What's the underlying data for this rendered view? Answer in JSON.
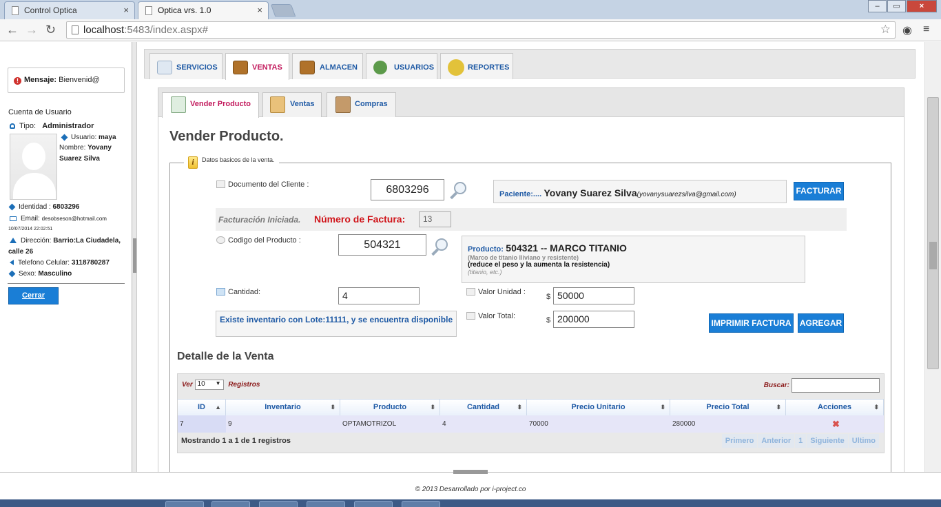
{
  "browser": {
    "tabs": [
      {
        "label": "Control Optica",
        "close": "×"
      },
      {
        "label": "Optica vrs. 1.0",
        "close": "×"
      }
    ],
    "url_host": "localhost",
    "url_rest": ":5483/index.aspx#",
    "window_buttons": [
      "–",
      "▭",
      "×"
    ]
  },
  "sidebar": {
    "message_label": "Mensaje:",
    "message_text": "Bienvenid@",
    "account_title": "Cuenta de Usuario",
    "tipo_label": "Tipo:",
    "tipo_value": "Administrador",
    "usuario_label": "Usuario:",
    "usuario_value": "maya",
    "nombre_label": "Nombre:",
    "nombre_value": "Yovany",
    "nombre_value2": "Suarez Silva",
    "identidad_label": "Identidad :",
    "identidad_value": "6803296",
    "email_label": "Email:",
    "email_value": "desobseson@hotmail.com",
    "timestamp": "10/07/2014 22:02:51",
    "direccion_label": "Dirección:",
    "direccion_value": "Barrio:La Ciudadela,",
    "direccion_value2": "calle 26",
    "telefono_label": "Telefono Celular:",
    "telefono_value": "3118780287",
    "sexo_label": "Sexo:",
    "sexo_value": "Masculino",
    "logout_label": "Cerrar Sesión"
  },
  "menu": {
    "items": [
      "SERVICIOS",
      "VENTAS",
      "ALMACEN",
      "USUARIOS",
      "REPORTES"
    ],
    "active": "VENTAS"
  },
  "subtabs": {
    "items": [
      "Vender Producto",
      "Ventas",
      "Compras"
    ],
    "active": "Vender Producto"
  },
  "form": {
    "title": "Vender Producto.",
    "legend": "Datos basicos de la venta.",
    "documento_label": "Documento del Cliente :",
    "documento_value": "6803296",
    "paciente_label": "Paciente:....",
    "paciente_name": "Yovany Suarez Silva",
    "paciente_email": "(yovanysuarezsilva@gmail.com)",
    "facturar_label": "FACTURAR",
    "facturacion_text": "Facturación Iniciada.",
    "numero_factura_label": "Número de Factura:",
    "numero_factura_value": "13",
    "codigo_label": "Codigo del Producto :",
    "codigo_value": "504321",
    "producto_label": "Producto:",
    "producto_title": "504321 -- MARCO TITANIO",
    "producto_line1": "(Marco de titanio lliviano y resistente)",
    "producto_line2": "(reduce el peso y la aumenta la resistencia)",
    "producto_line3": "(titanio, etc.)",
    "cantidad_label": "Cantidad:",
    "cantidad_value": "4",
    "valor_unidad_label": "Valor Unidad :",
    "valor_unidad_currency": "$",
    "valor_unidad_value": "50000",
    "valor_total_label": "Valor Total:",
    "valor_total_currency": "$",
    "valor_total_value": "200000",
    "inventario_msg": "Existe inventario con Lote:11111, y se encuentra disponible",
    "imprimir_label": "IMPRIMIR FACTURA",
    "agregar_label": "AGREGAR"
  },
  "detalle": {
    "title": "Detalle de la Venta",
    "ver_label": "Ver",
    "page_size": "10",
    "registros_label": "Registros",
    "buscar_label": "Buscar:",
    "columns": [
      "ID",
      "Inventario",
      "Producto",
      "Cantidad",
      "Precio Unitario",
      "Precio Total",
      "Acciones"
    ],
    "rows": [
      {
        "id": "7",
        "inventario": "9",
        "producto": "OPTAMOTRIZOL",
        "cantidad": "4",
        "precio_unitario": "70000",
        "precio_total": "280000",
        "accion": "✖"
      }
    ],
    "info": "Mostrando 1 a 1 de 1 registros",
    "pager": [
      "Primero",
      "Anterior",
      "1",
      "Siguiente",
      "Ultimo"
    ]
  },
  "footer": {
    "text": "© 2013   Desarrollado por i-project.co"
  }
}
